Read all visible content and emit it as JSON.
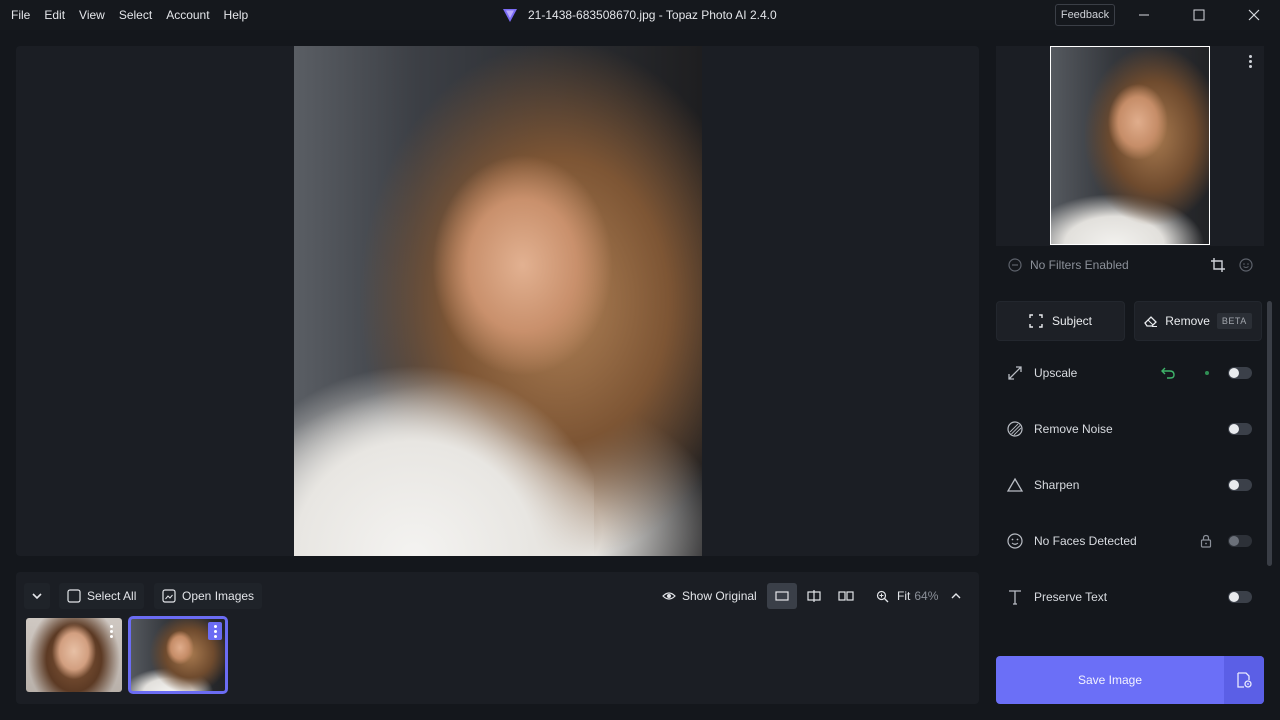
{
  "menu": {
    "items": [
      "File",
      "Edit",
      "View",
      "Select",
      "Account",
      "Help"
    ]
  },
  "window": {
    "title": "21-1438-683508670.jpg - Topaz Photo AI 2.4.0",
    "feedback_label": "Feedback"
  },
  "bottom_toolbar": {
    "select_all_label": "Select All",
    "open_images_label": "Open Images",
    "show_original_label": "Show Original",
    "zoom_mode": "Fit",
    "zoom_value": "64%"
  },
  "thumbnails": [
    {
      "name": "portrait-1",
      "selected": false
    },
    {
      "name": "portrait-2",
      "selected": true
    }
  ],
  "right_panel": {
    "filters_status": "No Filters Enabled",
    "subject_label": "Subject",
    "remove_label": "Remove",
    "remove_badge": "BETA",
    "tools": [
      {
        "label": "Upscale",
        "icon": "upscale-icon",
        "enabled": false
      },
      {
        "label": "Remove Noise",
        "icon": "noise-icon",
        "enabled": false
      },
      {
        "label": "Sharpen",
        "icon": "sharpen-icon",
        "enabled": false
      },
      {
        "label": "No Faces Detected",
        "icon": "face-icon",
        "enabled": false,
        "locked": true
      },
      {
        "label": "Preserve Text",
        "icon": "text-icon",
        "enabled": false
      }
    ],
    "save_label": "Save Image"
  },
  "colors": {
    "accent": "#6b6ff7",
    "background": "#14171c",
    "panel": "#1b1e24",
    "undo_green": "#3fb56b"
  }
}
